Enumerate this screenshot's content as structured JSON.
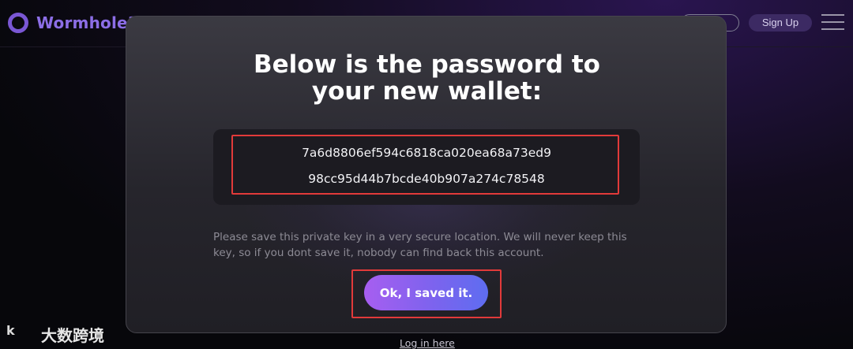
{
  "header": {
    "logo_text": "Wormhole3",
    "login_label": "",
    "signup_label": "Sign Up",
    "logo_icon": "wormhole-ring-icon",
    "menu_icon": "hamburger-menu-icon"
  },
  "modal": {
    "title_line1": "Below is the password to",
    "title_line2": "your new wallet:",
    "key_line1": "7a6d8806ef594c6818ca020ea68a73ed9",
    "key_line2": "98cc95d44b7bcde40b907a274c78548",
    "notice": "Please save this private key in a very secure location. We will never keep this key, so if you dont save it, nobody can find back this account.",
    "confirm_label": "Ok, I saved it."
  },
  "footer": {
    "login_link": "Log in here"
  },
  "watermark": {
    "logo_text": "k",
    "text": "大数跨境"
  },
  "colors": {
    "brand": "#8c6ee6",
    "button_gradient_start": "#a75ef0",
    "button_gradient_end": "#5e6df0",
    "highlight_outline": "#e23a3a"
  }
}
